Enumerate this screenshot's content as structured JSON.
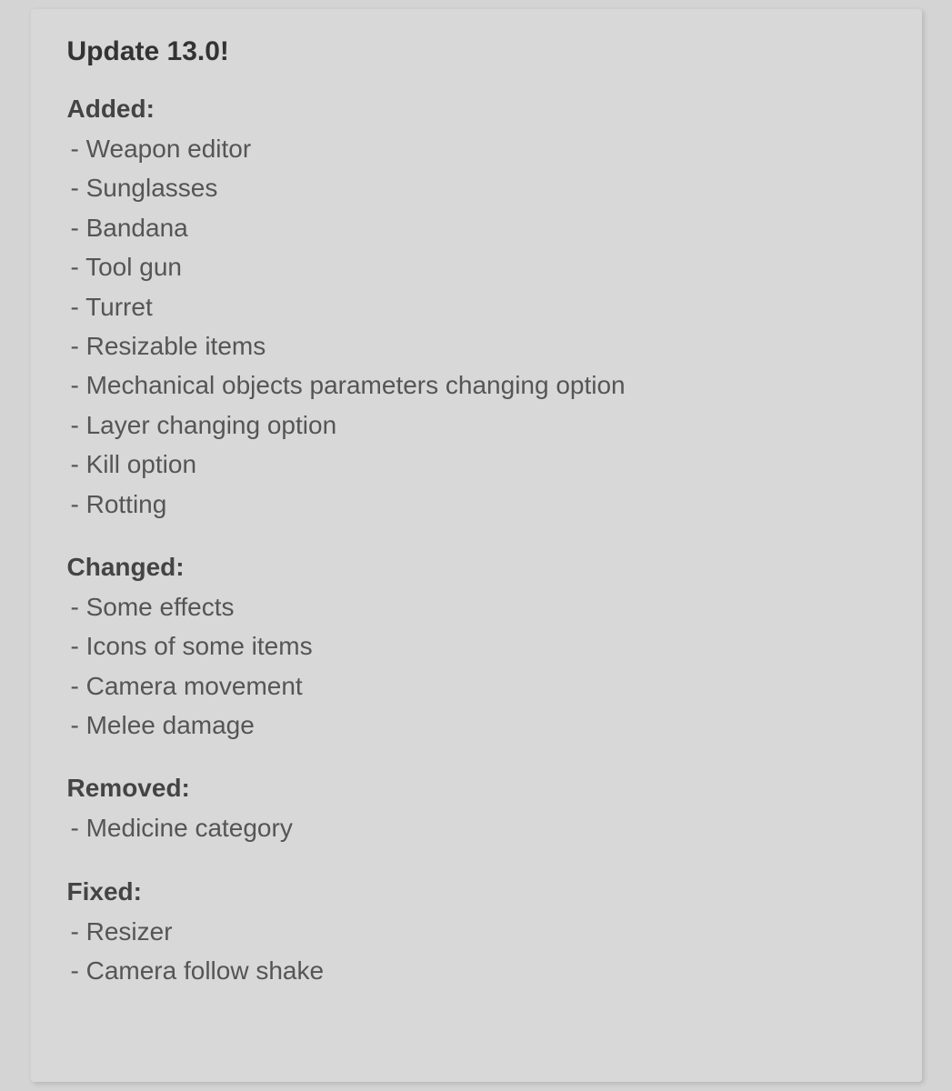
{
  "page": {
    "title": "Update 13.0!",
    "sections": [
      {
        "id": "added",
        "header": "Added:",
        "items": [
          "- Weapon editor",
          "- Sunglasses",
          "- Bandana",
          "- Tool gun",
          "- Turret",
          "- Resizable items",
          "- Mechanical objects parameters changing option",
          "- Layer changing option",
          "- Kill option",
          "- Rotting"
        ]
      },
      {
        "id": "changed",
        "header": "Changed:",
        "items": [
          "- Some effects",
          "- Icons of some items",
          "- Camera movement",
          "- Melee damage"
        ]
      },
      {
        "id": "removed",
        "header": "Removed:",
        "items": [
          "- Medicine category"
        ]
      },
      {
        "id": "fixed",
        "header": "Fixed:",
        "items": [
          "- Resizer",
          "- Camera follow shake"
        ]
      }
    ]
  }
}
